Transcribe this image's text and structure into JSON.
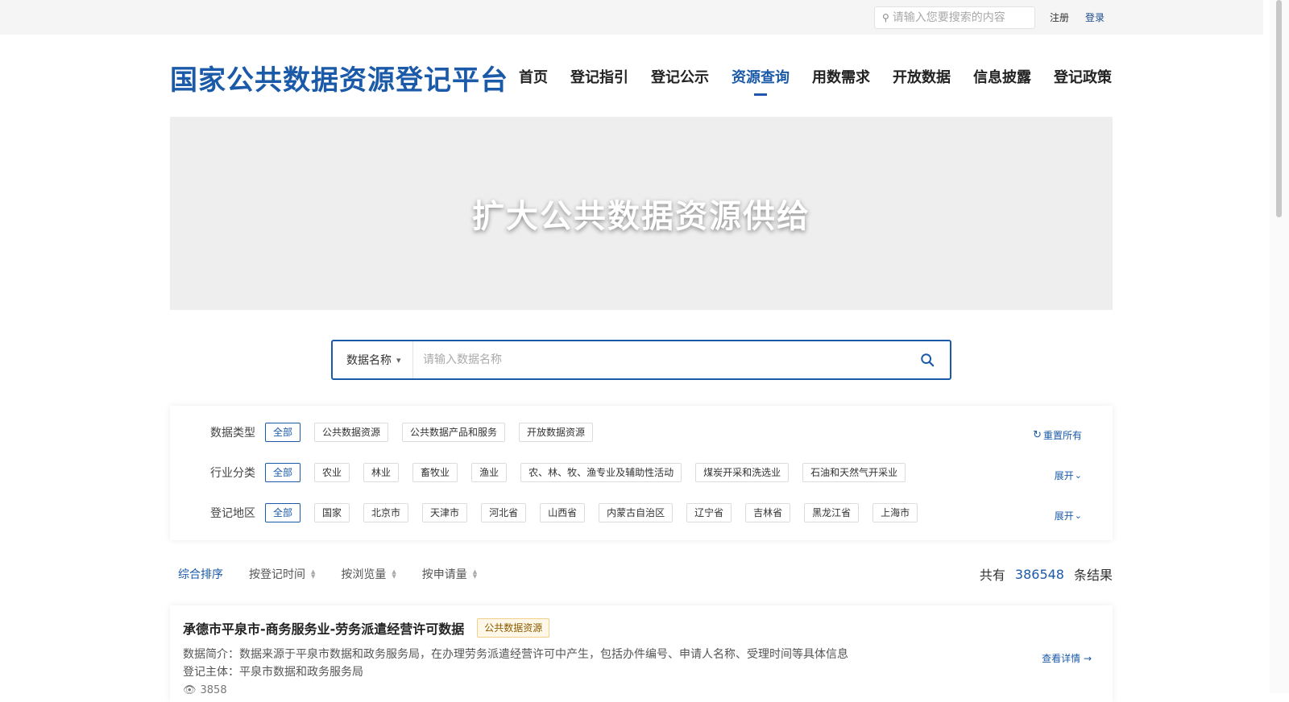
{
  "topbar": {
    "search_placeholder": "请输入您要搜索的内容",
    "search_icon": "search-icon",
    "register_label": "注册",
    "login_label": "登录"
  },
  "header": {
    "brand": "国家公共数据资源登记平台",
    "nav": [
      {
        "label": "首页",
        "active": false
      },
      {
        "label": "登记指引",
        "active": false
      },
      {
        "label": "登记公示",
        "active": false
      },
      {
        "label": "资源查询",
        "active": true
      },
      {
        "label": "用数需求",
        "active": false
      },
      {
        "label": "开放数据",
        "active": false
      },
      {
        "label": "信息披露",
        "active": false
      },
      {
        "label": "登记政策",
        "active": false
      }
    ]
  },
  "banner": {
    "text": "扩大公共数据资源供给"
  },
  "search": {
    "type_label": "数据名称",
    "placeholder": "请输入数据名称"
  },
  "filters": {
    "rows": [
      {
        "label": "数据类型",
        "chips": [
          "全部",
          "公共数据资源",
          "公共数据产品和服务",
          "开放数据资源"
        ],
        "action": "重置所有"
      },
      {
        "label": "行业分类",
        "chips": [
          "全部",
          "农业",
          "林业",
          "畜牧业",
          "渔业",
          "农、林、牧、渔专业及辅助性活动",
          "煤炭开采和洗选业",
          "石油和天然气开采业"
        ],
        "action": "展开"
      },
      {
        "label": "登记地区",
        "chips": [
          "全部",
          "国家",
          "北京市",
          "天津市",
          "河北省",
          "山西省",
          "内蒙古自治区",
          "辽宁省",
          "吉林省",
          "黑龙江省",
          "上海市"
        ],
        "action": "展开"
      }
    ]
  },
  "sort": {
    "items": [
      {
        "label": "综合排序",
        "active": true
      },
      {
        "label": "按登记时间",
        "active": false
      },
      {
        "label": "按浏览量",
        "active": false
      },
      {
        "label": "按申请量",
        "active": false
      }
    ],
    "count_prefix": "共有",
    "count": "386548",
    "count_suffix": "条结果"
  },
  "results": [
    {
      "title": "承德市平泉市-商务服务业-劳务派遣经营许可数据",
      "tag": "公共数据资源",
      "desc": "数据简介：数据来源于平泉市数据和政务服务局，在办理劳务派遣经营许可中产生，包括办件编号、申请人名称、受理时间等具体信息",
      "owner": "登记主体：平泉市数据和政务服务局",
      "views": "3858",
      "detail_label": "查看详情"
    }
  ],
  "colors": {
    "accent": "#1a5aa8",
    "tag_bg": "#fff8e8",
    "tag_border": "#f3cf8c"
  }
}
